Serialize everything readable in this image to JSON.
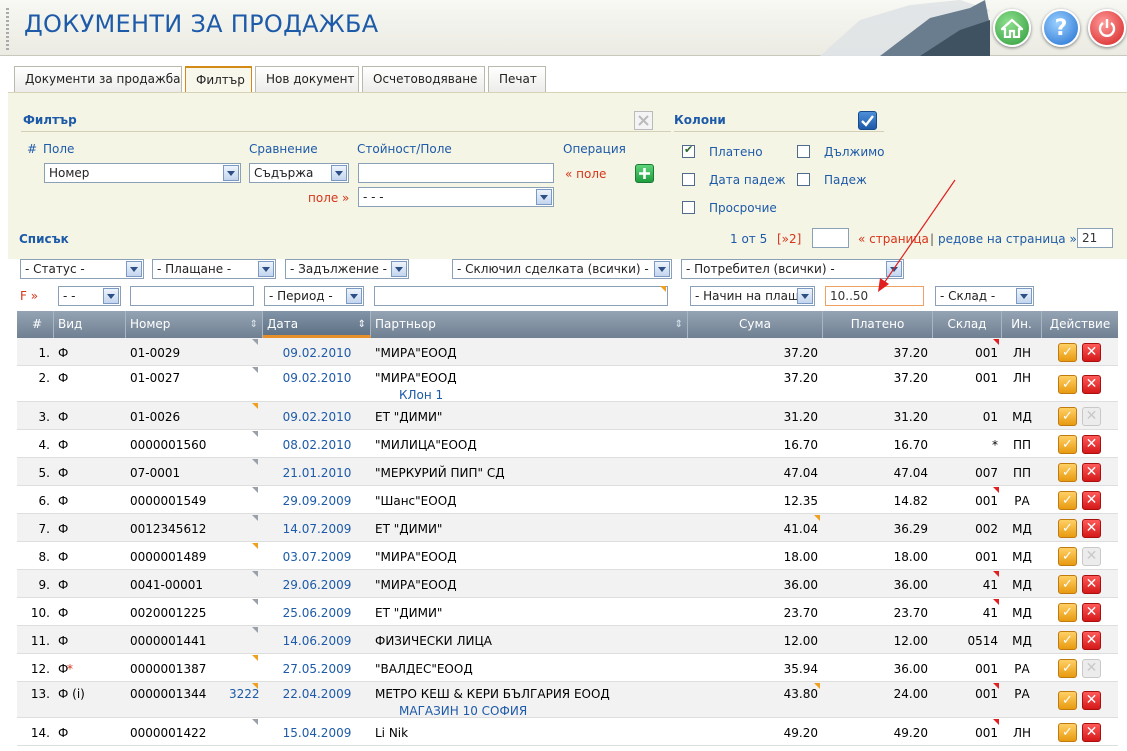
{
  "header": {
    "title": "ДОКУМЕНТИ ЗА ПРОДАЖБА",
    "help_glyph": "?"
  },
  "tabs": [
    {
      "label": "Документи за продажба"
    },
    {
      "label": "Филтър"
    },
    {
      "label": "Нов документ"
    },
    {
      "label": "Осчетоводяване"
    },
    {
      "label": "Печат"
    }
  ],
  "filter": {
    "title": "Филтър",
    "hash": "#",
    "field_label": "Поле",
    "compare_label": "Сравнение",
    "value_label": "Стойност/Поле",
    "operation_label": "Операция",
    "field_value": "Номер",
    "compare_value": "Съдържа",
    "value_input": "",
    "op_field_link": "« поле",
    "field_link": "поле »",
    "field_select_value": "- - -"
  },
  "columns": {
    "title": "Колони",
    "items": [
      {
        "label": "Платено",
        "checked": true
      },
      {
        "label": "Дължимо",
        "checked": false
      },
      {
        "label": "Дата падеж",
        "checked": false
      },
      {
        "label": "Падеж",
        "checked": false
      },
      {
        "label": "Просрочие",
        "checked": false
      }
    ]
  },
  "list": {
    "title": "Списък",
    "page_info": "1 от 5",
    "next": "[»2]",
    "page_input": "",
    "page_link": "« страница",
    "sep": "|",
    "rows_link": "редове на страница »",
    "rows_value": "21"
  },
  "filters_row1": {
    "status": "- Статус -",
    "payment": "- Плащане -",
    "debt": "- Задължение -",
    "dealer": "- Сключил сделката (всички) -",
    "user": "- Потребител (всички) -"
  },
  "filters_row2": {
    "f_label": "F »",
    "kind": "- -",
    "number": "",
    "period": "- Период -",
    "partner": "",
    "pay_method": "- Начин на плащ",
    "paid": "10..50",
    "store": "- Склад -"
  },
  "grid": {
    "headers": [
      "#",
      "Вид",
      "Номер",
      "Дата",
      "Партньор",
      "Сума",
      "Платено",
      "Склад",
      "Ин.",
      "Действие"
    ],
    "rows": [
      {
        "n": "1.",
        "kind": "Ф",
        "mark": "",
        "num": "01-0029",
        "extra": "",
        "date": "09.02.2010",
        "partner": "\"МИРА\"ЕООД",
        "sub": "",
        "sum": "37.20",
        "paid": "37.20",
        "store": "001",
        "in": "ЛН",
        "del": true
      },
      {
        "n": "2.",
        "kind": "Ф",
        "mark": "",
        "num": "01-0027",
        "extra": "",
        "date": "09.02.2010",
        "partner": "\"МИРА\"ЕООД",
        "sub": "КЛон 1",
        "sum": "37.20",
        "paid": "37.20",
        "store": "001",
        "in": "ЛН",
        "del": true
      },
      {
        "n": "3.",
        "kind": "Ф",
        "mark": "",
        "num": "01-0026",
        "extra": "",
        "date": "09.02.2010",
        "partner": "ЕТ \"ДИМИ\"",
        "sub": "",
        "sum": "31.20",
        "paid": "31.20",
        "store": "01",
        "in": "МД",
        "del": false
      },
      {
        "n": "4.",
        "kind": "Ф",
        "mark": "",
        "num": "0000001560",
        "extra": "",
        "date": "08.02.2010",
        "partner": "\"МИЛИЦА\"ЕООД",
        "sub": "",
        "sum": "16.70",
        "paid": "16.70",
        "store": "*",
        "in": "ПП",
        "del": true
      },
      {
        "n": "5.",
        "kind": "Ф",
        "mark": "",
        "num": "07-0001",
        "extra": "",
        "date": "21.01.2010",
        "partner": "\"МЕРКУРИЙ ПИП\" СД",
        "sub": "",
        "sum": "47.04",
        "paid": "47.04",
        "store": "007",
        "in": "ПП",
        "del": true
      },
      {
        "n": "6.",
        "kind": "Ф",
        "mark": "",
        "num": "0000001549",
        "extra": "",
        "date": "29.09.2009",
        "partner": "\"Шанс\"ЕООД",
        "sub": "",
        "sum": "12.35",
        "paid": "14.82",
        "store": "001",
        "in": "РА",
        "del": true
      },
      {
        "n": "7.",
        "kind": "Ф",
        "mark": "",
        "num": "0012345612",
        "extra": "",
        "date": "14.07.2009",
        "partner": "ЕТ \"ДИМИ\"",
        "sub": "",
        "sum": "41.04",
        "paid": "36.29",
        "store": "002",
        "in": "МД",
        "del": true
      },
      {
        "n": "8.",
        "kind": "Ф",
        "mark": "",
        "num": "0000001489",
        "extra": "",
        "date": "03.07.2009",
        "partner": "\"МИРА\"ЕООД",
        "sub": "",
        "sum": "18.00",
        "paid": "18.00",
        "store": "001",
        "in": "МД",
        "del": false
      },
      {
        "n": "9.",
        "kind": "Ф",
        "mark": "",
        "num": "0041-00001",
        "extra": "",
        "date": "29.06.2009",
        "partner": "\"МИРА\"ЕООД",
        "sub": "",
        "sum": "36.00",
        "paid": "36.00",
        "store": "41",
        "in": "МД",
        "del": true
      },
      {
        "n": "10.",
        "kind": "Ф",
        "mark": "",
        "num": "0020001225",
        "extra": "",
        "date": "25.06.2009",
        "partner": "ЕТ \"ДИМИ\"",
        "sub": "",
        "sum": "23.70",
        "paid": "23.70",
        "store": "41",
        "in": "МД",
        "del": true
      },
      {
        "n": "11.",
        "kind": "Ф",
        "mark": "",
        "num": "0000001441",
        "extra": "",
        "date": "14.06.2009",
        "partner": "ФИЗИЧЕСКИ ЛИЦА",
        "sub": "",
        "sum": "12.00",
        "paid": "12.00",
        "store": "0514",
        "in": "МД",
        "del": true
      },
      {
        "n": "12.",
        "kind": "Ф",
        "mark": "*",
        "num": "0000001387",
        "extra": "",
        "date": "27.05.2009",
        "partner": "\"ВАЛДЕС\"ЕООД",
        "sub": "",
        "sum": "35.94",
        "paid": "36.00",
        "store": "001",
        "in": "РА",
        "del": false
      },
      {
        "n": "13.",
        "kind": "Ф (i)",
        "mark": "",
        "num": "0000001344",
        "extra": "3222",
        "date": "22.04.2009",
        "partner": "МЕТРО КЕШ & КЕРИ БЪЛГАРИЯ ЕООД",
        "sub": "МАГАЗИН 10 СОФИЯ",
        "sum": "43.80",
        "paid": "24.00",
        "store": "001",
        "in": "РА",
        "del": true
      },
      {
        "n": "14.",
        "kind": "Ф",
        "mark": "",
        "num": "0000001422",
        "extra": "",
        "date": "15.04.2009",
        "partner": "Li Nik",
        "sub": "",
        "sum": "49.20",
        "paid": "49.20",
        "store": "001",
        "in": "ЛН",
        "del": true
      }
    ]
  },
  "colors": {
    "accent": "#1d5aa8",
    "arrow": "#e02020",
    "orange": "#e7902a"
  }
}
